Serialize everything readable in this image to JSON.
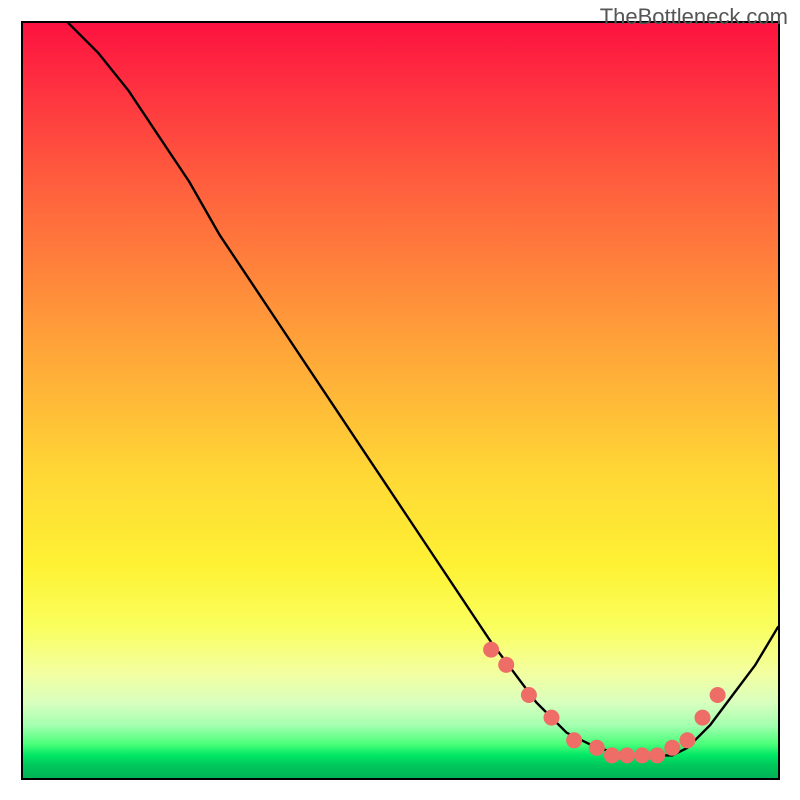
{
  "watermark": "TheBottleneck.com",
  "chart_data": {
    "type": "line",
    "title": "",
    "xlabel": "",
    "ylabel": "",
    "xlim": [
      0,
      100
    ],
    "ylim": [
      0,
      100
    ],
    "note": "Axes are not labeled in the image; values are normalized 0–100 estimates from pixel positions. y=0 is bottom of plot, y=100 is top.",
    "series": [
      {
        "name": "bottleneck-curve",
        "color": "#000000",
        "x": [
          6,
          10,
          14,
          18,
          22,
          26,
          30,
          34,
          38,
          42,
          46,
          50,
          54,
          58,
          60,
          62,
          65,
          68,
          72,
          76,
          80,
          84,
          86,
          88,
          91,
          94,
          97,
          100
        ],
        "y": [
          100,
          96,
          91,
          85,
          79,
          72,
          66,
          60,
          54,
          48,
          42,
          36,
          30,
          24,
          21,
          18,
          14,
          10,
          6,
          4,
          3,
          3,
          3,
          4,
          7,
          11,
          15,
          20
        ]
      }
    ],
    "markers": [
      {
        "name": "highlight-dots",
        "color": "#ee6d66",
        "radius_px": 8,
        "x": [
          62,
          64,
          67,
          70,
          73,
          76,
          78,
          80,
          82,
          84,
          86,
          88,
          90,
          92
        ],
        "y": [
          17,
          15,
          11,
          8,
          5,
          4,
          3,
          3,
          3,
          3,
          4,
          5,
          8,
          11
        ]
      }
    ]
  }
}
